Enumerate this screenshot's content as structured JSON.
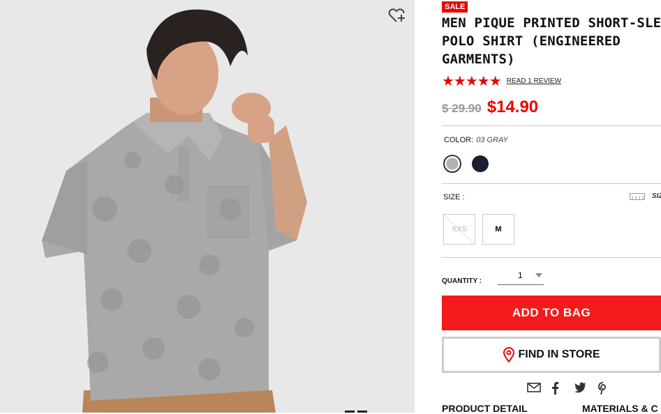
{
  "product": {
    "badge": "SALE",
    "title_line1": "MEN PIQUE PRINTED SHORT-SLE",
    "title_line2": "POLO SHIRT (ENGINEERED",
    "title_line3": "GARMENTS)",
    "rating_stars": 5,
    "stars_display": "★★★★★",
    "review_link": "READ 1 REVIEW",
    "old_price": "$ 29.90",
    "new_price": "$14.90"
  },
  "color": {
    "label": "COLOR:",
    "selected": "03 GRAY",
    "swatches": [
      "gray-swatch",
      "navy-swatch"
    ]
  },
  "size": {
    "label": "SIZE :",
    "guide_label": "SIZ",
    "options": [
      {
        "label": "XXS",
        "available": false
      },
      {
        "label": "M",
        "available": true
      }
    ]
  },
  "quantity": {
    "label": "QUANTITY :",
    "value": "1"
  },
  "actions": {
    "add_to_bag": "ADD TO BAG",
    "find_in_store": "FIND IN STORE"
  },
  "share_icons": [
    "mail-icon",
    "facebook-icon",
    "twitter-icon",
    "pinterest-icon"
  ],
  "tabs": {
    "product_detail": "PRODUCT DETAIL",
    "materials": "MATERIALS & C"
  },
  "colors": {
    "accent": "#f21a1a",
    "sale_red": "#e00000",
    "navy": "#1a1f33",
    "gray": "#b2b2b2"
  }
}
